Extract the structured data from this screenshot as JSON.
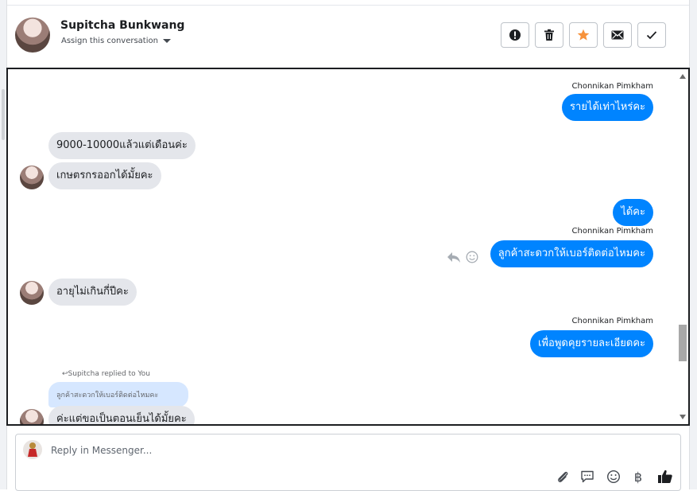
{
  "header": {
    "name": "Supitcha Bunkwang",
    "assign_label": "Assign this conversation"
  },
  "toolbar": {
    "icons": [
      "alert-icon",
      "trash-icon",
      "star-icon",
      "envelope-icon",
      "checkmark-icon"
    ],
    "accent_star": "#f7923b"
  },
  "messages": [
    {
      "sender": "Chonnikan Pimkham",
      "text": "รายได้เท่าไหร่คะ",
      "dir": "out"
    },
    {
      "text": "9000-10000แล้วแต่เดือนค่ะ",
      "dir": "in"
    },
    {
      "text": "เกษตรกรออกได้มั้ยคะ",
      "dir": "in"
    },
    {
      "text": "ได้คะ",
      "dir": "out"
    },
    {
      "sender": "Chonnikan Pimkham",
      "text": "ลูกค้าสะดวกให้เบอร์ติดต่อไหมคะ",
      "dir": "out"
    },
    {
      "text": "อายุไม่เกินกี่ปีคะ",
      "dir": "in"
    },
    {
      "sender": "Chonnikan Pimkham",
      "text": "เพื่อพูดคุยรายละเอียดคะ",
      "dir": "out"
    },
    {
      "reply_note": "Supitcha replied to You",
      "quoted": "ลูกค้าสะดวกให้เบอร์ติดต่อไหมคะ",
      "text": "ค่ะแต่ขอเป็นตอนเย็นได้มั้ยคะ",
      "dir": "in"
    }
  ],
  "composer": {
    "placeholder": "Reply in Messenger...",
    "baht_symbol": "฿"
  },
  "colors": {
    "outgoing_bubble": "#0084ff",
    "incoming_bubble": "#e4e6eb",
    "quoted_bubble": "#d6e7ff"
  }
}
